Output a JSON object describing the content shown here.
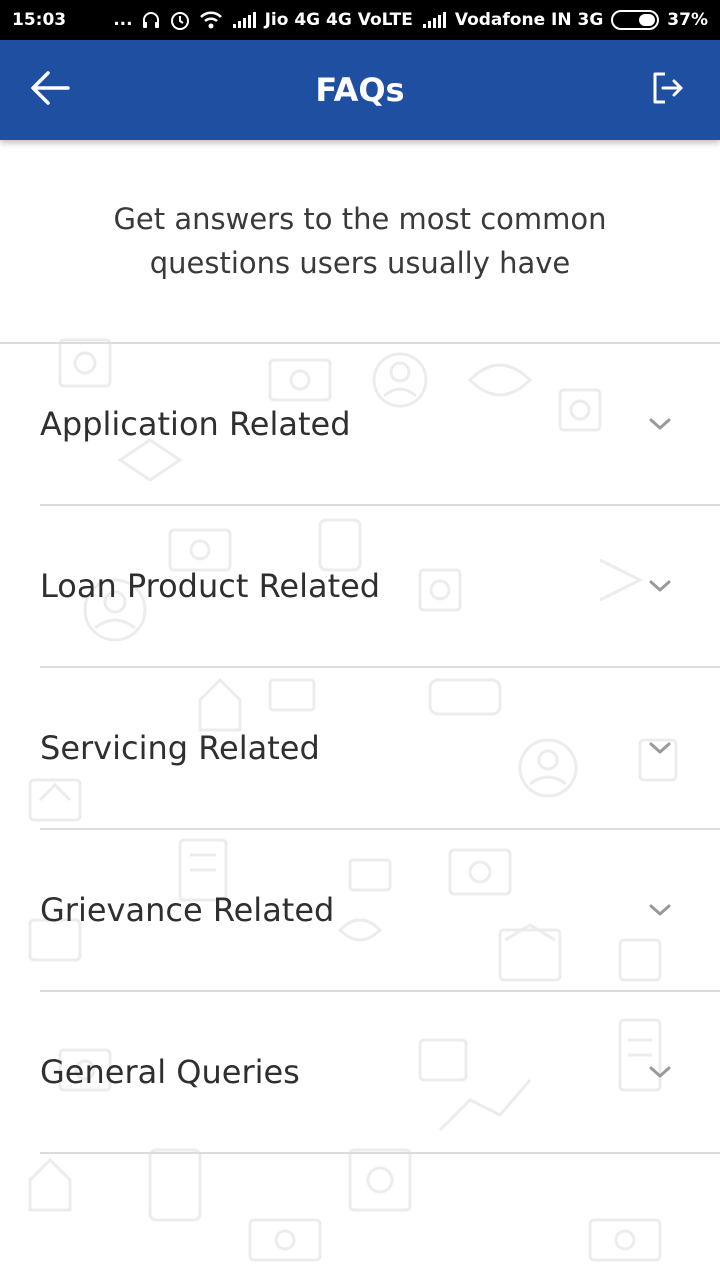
{
  "status_bar": {
    "time": "15:03",
    "dots": "...",
    "carrier1": "Jio 4G 4G VoLTE",
    "carrier2": "Vodafone IN 3G",
    "battery": "37%",
    "icons": [
      "headphone-icon",
      "alarm-icon",
      "wifi-icon",
      "signal-icon",
      "signal-icon",
      "battery-icon"
    ]
  },
  "app_bar": {
    "title": "FAQs",
    "background": "#1e4fa0",
    "back_icon": "back-arrow-icon",
    "logout_icon": "logout-icon"
  },
  "intro": {
    "text": "Get answers to the most common questions users usually have"
  },
  "faq": {
    "items": [
      {
        "label": "Application Related",
        "icon": "chevron-down-icon"
      },
      {
        "label": "Loan Product Related",
        "icon": "chevron-down-icon"
      },
      {
        "label": "Servicing Related",
        "icon": "chevron-down-icon"
      },
      {
        "label": "Grievance Related",
        "icon": "chevron-down-icon"
      },
      {
        "label": "General Queries",
        "icon": "chevron-down-icon"
      }
    ]
  }
}
